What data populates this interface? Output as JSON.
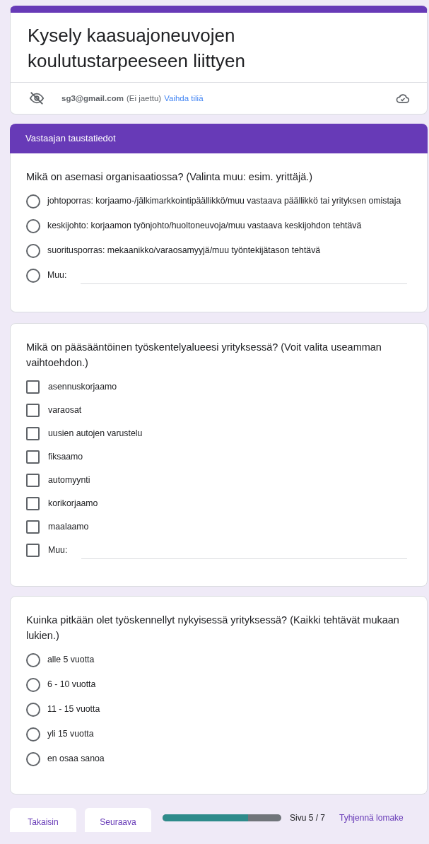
{
  "form": {
    "title": "Kysely kaasuajoneuvojen koulutustarpeeseen liittyen",
    "account": {
      "email": "sg3@gmail.com",
      "note": "(Ei jaettu)",
      "switch_link": "Vaihda tiliä"
    }
  },
  "section": {
    "title": "Vastaajan taustatiedot"
  },
  "questions": [
    {
      "text": "Mikä on asemasi organisaatiossa? (Valinta muu: esim. yrittäjä.)",
      "kind": "radio",
      "options": [
        {
          "label": "johtoporras: korjaamo-/jälkimarkkointipäällikkö/muu vastaava päällikkö tai yrityksen omistaja",
          "selected": false
        },
        {
          "label": "keskijohto: korjaamon työnjohto/huoltoneuvoja/muu vastaava keskijohdon tehtävä",
          "selected": false
        },
        {
          "label": "suoritusporras: mekaanikko/varaosamyyjä/muu työntekijätason tehtävä",
          "selected": false
        },
        {
          "label": "Muu:",
          "selected": false,
          "other": true
        }
      ]
    },
    {
      "text": "Mikä on pääsääntöinen työskentelyalueesi yrityksessä? (Voit valita useamman vaihtoehdon.)",
      "kind": "checkbox",
      "options": [
        {
          "label": "asennuskorjaamo",
          "selected": false
        },
        {
          "label": "varaosat",
          "selected": false
        },
        {
          "label": "uusien autojen varustelu",
          "selected": false
        },
        {
          "label": "fiksaamo",
          "selected": false
        },
        {
          "label": "automyynti",
          "selected": false
        },
        {
          "label": "korikorjaamo",
          "selected": false
        },
        {
          "label": "maalaamo",
          "selected": false
        },
        {
          "label": "Muu:",
          "selected": false,
          "other": true
        }
      ]
    },
    {
      "text": "Kuinka pitkään olet työskennellyt nykyisessä yrityksessä? (Kaikki tehtävät mukaan lukien.)",
      "kind": "radio",
      "options": [
        {
          "label": "alle 5 vuotta",
          "selected": false
        },
        {
          "label": "6 - 10 vuotta",
          "selected": false
        },
        {
          "label": "11 - 15 vuotta",
          "selected": false
        },
        {
          "label": "yli 15 vuotta",
          "selected": false
        },
        {
          "label": "en osaa sanoa",
          "selected": false
        }
      ]
    }
  ],
  "footer": {
    "back_button": "Takaisin",
    "next_button": "Seuraava",
    "progress": {
      "level": 0.72
    },
    "page_label": "Sivu 5 / 7",
    "clear_link": "Tyhjennä lomake"
  }
}
